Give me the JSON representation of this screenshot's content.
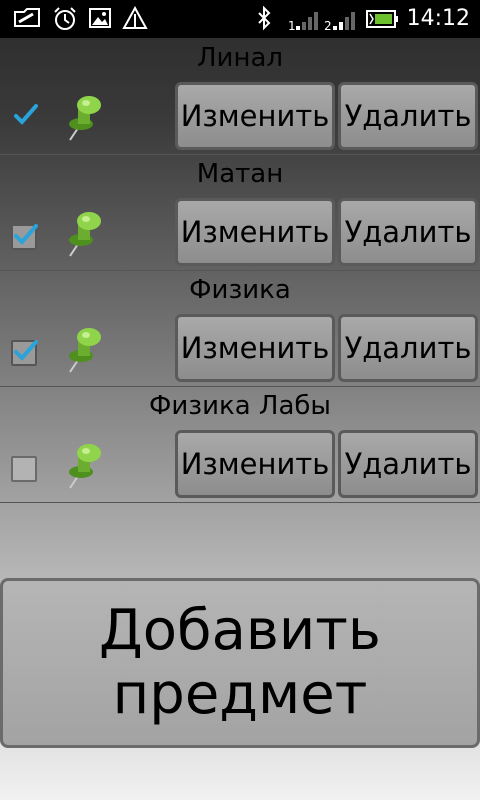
{
  "status_bar": {
    "time": "14:12",
    "icons": [
      "usb-debugging-icon",
      "alarm-icon",
      "gallery-icon",
      "signal-triangle-icon",
      "bluetooth-icon",
      "signal-1-icon",
      "signal-2-icon",
      "battery-icon"
    ]
  },
  "subjects": [
    {
      "name": "Линал",
      "checked": true,
      "edit_label": "Изменить",
      "delete_label": "Удалить"
    },
    {
      "name": "Матан",
      "checked": true,
      "edit_label": "Изменить",
      "delete_label": "Удалить"
    },
    {
      "name": "Физика",
      "checked": true,
      "edit_label": "Изменить",
      "delete_label": "Удалить"
    },
    {
      "name": "Физика Лабы",
      "checked": false,
      "edit_label": "Изменить",
      "delete_label": "Удалить"
    }
  ],
  "add_button": {
    "line1": "Добавить",
    "line2": "предмет"
  },
  "colors": {
    "check_accent": "#29a3d9",
    "pin_green": "#7cc241"
  }
}
